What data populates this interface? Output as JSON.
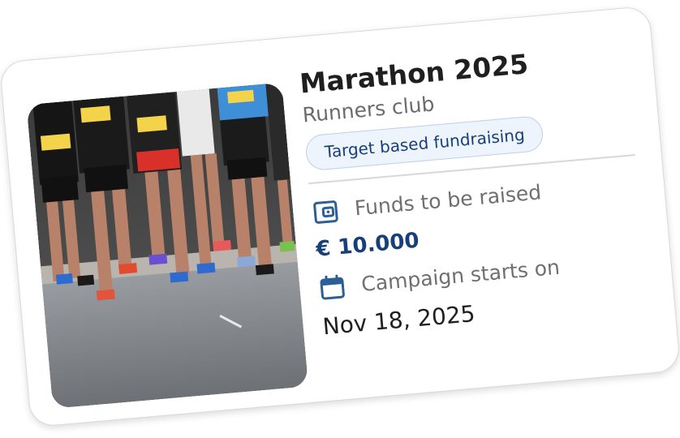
{
  "campaign": {
    "title": "Marathon 2025",
    "organizer": "Runners club",
    "tag": "Target based fundraising",
    "image_alt": "Marathon runners on a road",
    "funds_label": "Funds to be raised",
    "funds_amount": "€ 10.000",
    "start_label": "Campaign starts on",
    "start_date": "Nov 18, 2025"
  },
  "icons": {
    "funds": "wallet-icon",
    "start": "calendar-icon"
  },
  "colors": {
    "accent": "#173f7a",
    "icon": "#2c5f96",
    "tag_bg": "#eef4fb",
    "tag_border": "#bcd0e8",
    "muted_text": "#6f6f6f"
  }
}
